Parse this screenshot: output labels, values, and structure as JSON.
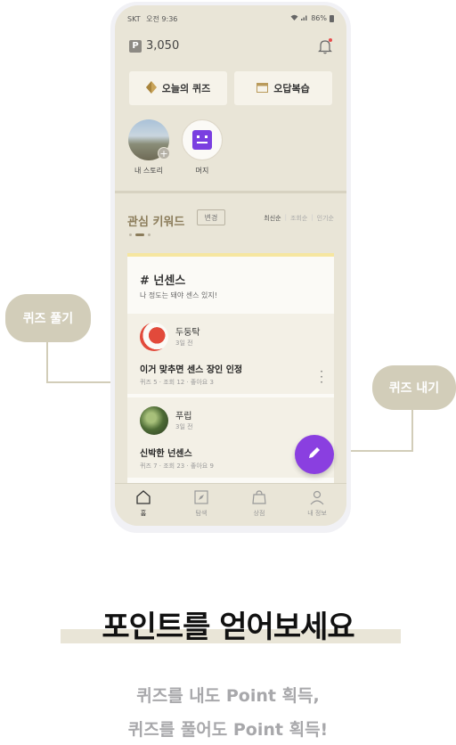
{
  "status": {
    "carrier": "SKT",
    "time": "오전 9:36",
    "battery": "86%"
  },
  "points": {
    "icon": "P",
    "value": "3,050"
  },
  "actions": {
    "today_quiz": "오늘의 퀴즈",
    "wrong_review": "오답복습"
  },
  "stories": [
    {
      "label": "내 스토리"
    },
    {
      "label": "머지"
    }
  ],
  "keywords": {
    "title": "관심 키워드",
    "change": "변경",
    "sort": [
      "최신순",
      "조회순",
      "인기순"
    ]
  },
  "card": {
    "tag": "# 넌센스",
    "desc": "나 정도는 돼야 센스 있지!",
    "posts": [
      {
        "author": "두둥탁",
        "ago": "3일 전",
        "title": "이거 맞추면 센스 장인 인정",
        "meta": "퀴즈 5 · 조회 12 · 좋아요 3"
      },
      {
        "author": "푸립",
        "ago": "3일 전",
        "title": "신박한 넌센스",
        "meta": "퀴즈 7 · 조회 23 · 좋아요 9"
      }
    ]
  },
  "tabs": [
    {
      "label": "홈",
      "icon": "home-icon"
    },
    {
      "label": "탐색",
      "icon": "compass-icon"
    },
    {
      "label": "상점",
      "icon": "bag-icon"
    },
    {
      "label": "내 정보",
      "icon": "person-icon"
    }
  ],
  "callouts": {
    "solve": "퀴즈 풀기",
    "make": "퀴즈 내기"
  },
  "headline": "포인트를 얻어보세요",
  "sub": [
    "퀴즈를 내도 Point 획득,",
    "퀴즈를 풀어도 Point 획득!"
  ],
  "colors": {
    "accent": "#8a3fe0",
    "bg": "#e9e5d7",
    "callout": "#d2cdb9"
  }
}
